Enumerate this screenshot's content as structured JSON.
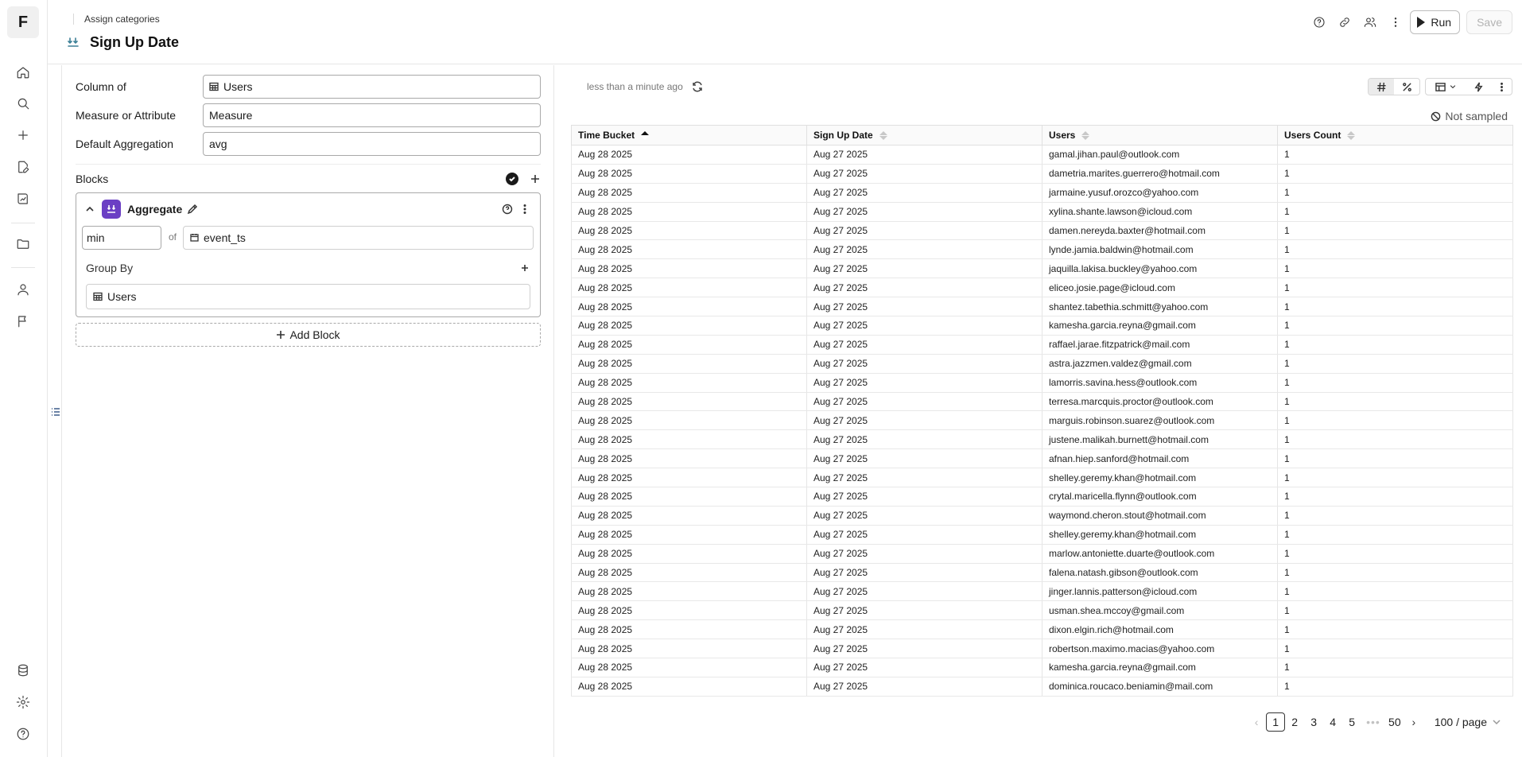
{
  "app": {
    "logo_letter": "F"
  },
  "header": {
    "breadcrumb": "Assign categories",
    "title": "Sign Up Date",
    "run_label": "Run",
    "save_label": "Save"
  },
  "config": {
    "column_of_label": "Column of",
    "column_of_value": "Users",
    "measure_label": "Measure or Attribute",
    "measure_value": "Measure",
    "default_agg_label": "Default Aggregation",
    "default_agg_value": "avg",
    "blocks_label": "Blocks",
    "block": {
      "name": "Aggregate",
      "function": "min",
      "of_label": "of",
      "column": "event_ts",
      "group_by_label": "Group By",
      "group_by_value": "Users"
    },
    "add_block_label": "Add Block"
  },
  "results": {
    "updated": "less than a minute ago",
    "not_sampled": "Not sampled",
    "columns": [
      "Time Bucket",
      "Sign Up Date",
      "Users",
      "Users Count"
    ],
    "rows": [
      [
        "Aug 28 2025",
        "Aug 27 2025",
        "gamal.jihan.paul@outlook.com",
        "1"
      ],
      [
        "Aug 28 2025",
        "Aug 27 2025",
        "dametria.marites.guerrero@hotmail.com",
        "1"
      ],
      [
        "Aug 28 2025",
        "Aug 27 2025",
        "jarmaine.yusuf.orozco@yahoo.com",
        "1"
      ],
      [
        "Aug 28 2025",
        "Aug 27 2025",
        "xylina.shante.lawson@icloud.com",
        "1"
      ],
      [
        "Aug 28 2025",
        "Aug 27 2025",
        "damen.nereyda.baxter@hotmail.com",
        "1"
      ],
      [
        "Aug 28 2025",
        "Aug 27 2025",
        "lynde.jamia.baldwin@hotmail.com",
        "1"
      ],
      [
        "Aug 28 2025",
        "Aug 27 2025",
        "jaquilla.lakisa.buckley@yahoo.com",
        "1"
      ],
      [
        "Aug 28 2025",
        "Aug 27 2025",
        "eliceo.josie.page@icloud.com",
        "1"
      ],
      [
        "Aug 28 2025",
        "Aug 27 2025",
        "shantez.tabethia.schmitt@yahoo.com",
        "1"
      ],
      [
        "Aug 28 2025",
        "Aug 27 2025",
        "kamesha.garcia.reyna@gmail.com",
        "1"
      ],
      [
        "Aug 28 2025",
        "Aug 27 2025",
        "raffael.jarae.fitzpatrick@mail.com",
        "1"
      ],
      [
        "Aug 28 2025",
        "Aug 27 2025",
        "astra.jazzmen.valdez@gmail.com",
        "1"
      ],
      [
        "Aug 28 2025",
        "Aug 27 2025",
        "lamorris.savina.hess@outlook.com",
        "1"
      ],
      [
        "Aug 28 2025",
        "Aug 27 2025",
        "terresa.marcquis.proctor@outlook.com",
        "1"
      ],
      [
        "Aug 28 2025",
        "Aug 27 2025",
        "marguis.robinson.suarez@outlook.com",
        "1"
      ],
      [
        "Aug 28 2025",
        "Aug 27 2025",
        "justene.malikah.burnett@hotmail.com",
        "1"
      ],
      [
        "Aug 28 2025",
        "Aug 27 2025",
        "afnan.hiep.sanford@hotmail.com",
        "1"
      ],
      [
        "Aug 28 2025",
        "Aug 27 2025",
        "shelley.geremy.khan@hotmail.com",
        "1"
      ],
      [
        "Aug 28 2025",
        "Aug 27 2025",
        "crytal.maricella.flynn@outlook.com",
        "1"
      ],
      [
        "Aug 28 2025",
        "Aug 27 2025",
        "waymond.cheron.stout@hotmail.com",
        "1"
      ],
      [
        "Aug 28 2025",
        "Aug 27 2025",
        "shelley.geremy.khan@hotmail.com",
        "1"
      ],
      [
        "Aug 28 2025",
        "Aug 27 2025",
        "marlow.antoniette.duarte@outlook.com",
        "1"
      ],
      [
        "Aug 28 2025",
        "Aug 27 2025",
        "falena.natash.gibson@outlook.com",
        "1"
      ],
      [
        "Aug 28 2025",
        "Aug 27 2025",
        "jinger.lannis.patterson@icloud.com",
        "1"
      ],
      [
        "Aug 28 2025",
        "Aug 27 2025",
        "usman.shea.mccoy@gmail.com",
        "1"
      ],
      [
        "Aug 28 2025",
        "Aug 27 2025",
        "dixon.elgin.rich@hotmail.com",
        "1"
      ],
      [
        "Aug 28 2025",
        "Aug 27 2025",
        "robertson.maximo.macias@yahoo.com",
        "1"
      ],
      [
        "Aug 28 2025",
        "Aug 27 2025",
        "kamesha.garcia.reyna@gmail.com",
        "1"
      ],
      [
        "Aug 28 2025",
        "Aug 27 2025",
        "dominica.roucaco.beniamin@mail.com",
        "1"
      ]
    ]
  },
  "pagination": {
    "pages": [
      "1",
      "2",
      "3",
      "4",
      "5"
    ],
    "current": "1",
    "ellipsis": "•••",
    "last": "50",
    "page_size": "100 / page"
  }
}
